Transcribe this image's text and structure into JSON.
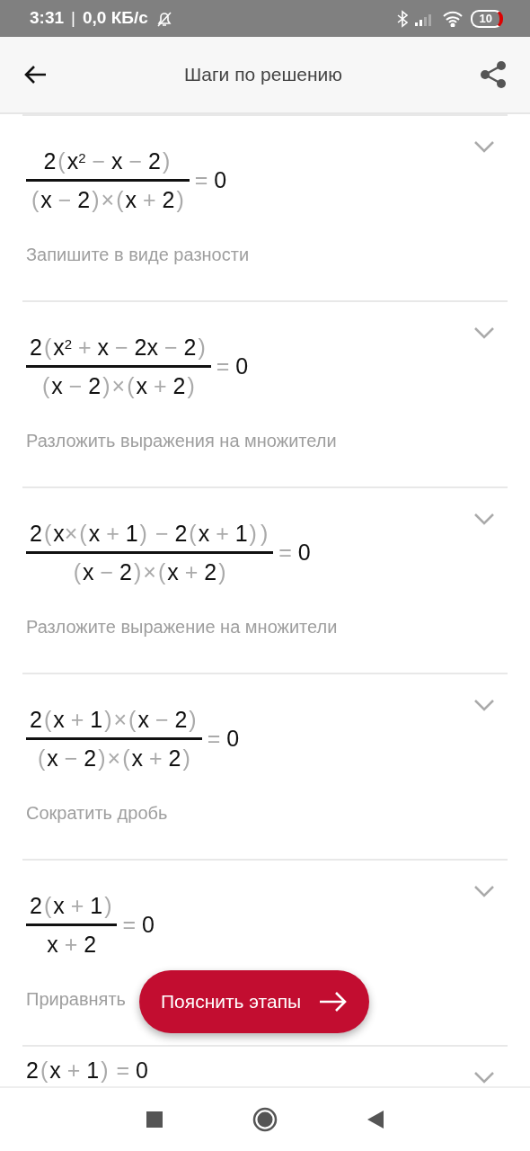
{
  "status_bar": {
    "time": "3:31",
    "separator": "|",
    "speed": "0,0 КБ/с",
    "battery": "10"
  },
  "app_bar": {
    "title": "Шаги по решению"
  },
  "steps": [
    {
      "kind": "fraction",
      "numerator": "2(x$^{2}$ − x − 2)",
      "denominator": "(x − 2)×(x + 2)",
      "rhs": "= 0",
      "description": "Запишите в виде разности",
      "expanded": false
    },
    {
      "kind": "fraction",
      "numerator": "2(x$^{2}$ + x − 2x − 2)",
      "denominator": "(x − 2)×(x + 2)",
      "rhs": "= 0",
      "description": "Разложить выражения на множители",
      "expanded": false
    },
    {
      "kind": "fraction",
      "numerator": "2(x×(x + 1) − 2(x + 1))",
      "denominator": "(x − 2)×(x + 2)",
      "rhs": "= 0",
      "description": "Разложите выражение на множители",
      "expanded": false
    },
    {
      "kind": "fraction",
      "numerator": "2(x + 1)×(x − 2)",
      "denominator": "(x − 2)×(x + 2)",
      "rhs": "= 0",
      "description": "Сократить дробь",
      "expanded": false
    },
    {
      "kind": "fraction",
      "numerator": "2(x + 1)",
      "denominator": "x + 2",
      "rhs": "= 0",
      "description": "Приравнять",
      "expanded": false
    },
    {
      "kind": "equation",
      "expression": "2(x + 1) = 0",
      "expanded": false
    }
  ],
  "explain_button": {
    "label": "Пояснить этапы"
  }
}
